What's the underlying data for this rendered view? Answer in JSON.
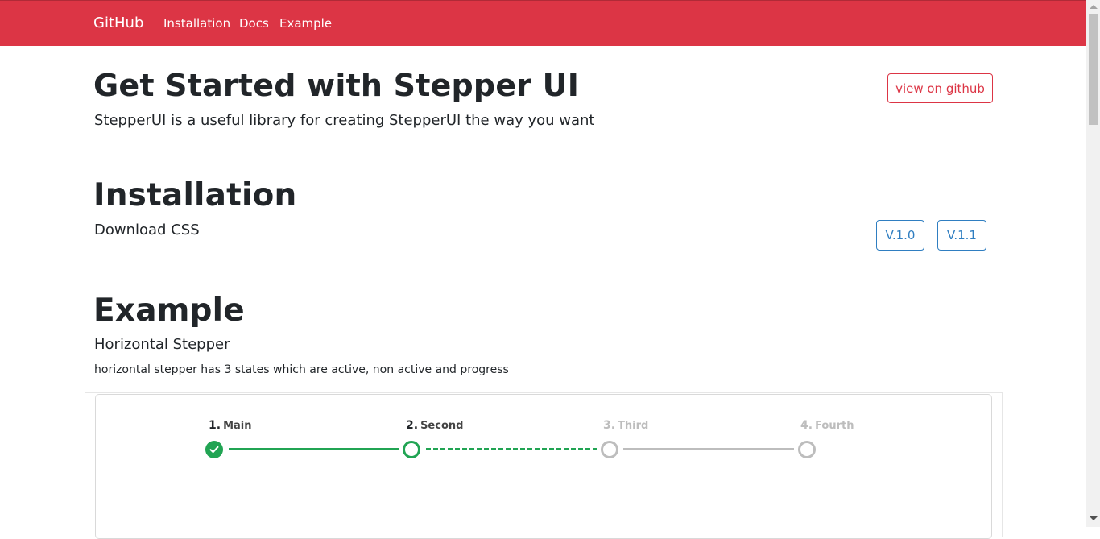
{
  "navbar": {
    "brand": "GitHub",
    "links": [
      "Installation",
      "Docs",
      "Example"
    ],
    "color": "#dc3545"
  },
  "hero": {
    "title": "Get Started with Stepper UI",
    "lead": "StepperUI is a useful library for creating StepperUI the way you want",
    "github_button": "view on github"
  },
  "installation": {
    "title": "Installation",
    "subtitle": "Download CSS",
    "versions": [
      "V.1.0",
      "V.1.1"
    ]
  },
  "example": {
    "title": "Example",
    "subtitle": "Horizontal Stepper",
    "description": "horizontal stepper has 3 states which are active, non active and progress"
  },
  "stepper": {
    "steps": [
      {
        "num": "1.",
        "name": "Main",
        "state": "done"
      },
      {
        "num": "2.",
        "name": "Second",
        "state": "progress"
      },
      {
        "num": "3.",
        "name": "Third",
        "state": "idle"
      },
      {
        "num": "4.",
        "name": "Fourth",
        "state": "idle"
      }
    ],
    "active_color": "#21a453",
    "idle_color": "#bdbdbd"
  }
}
